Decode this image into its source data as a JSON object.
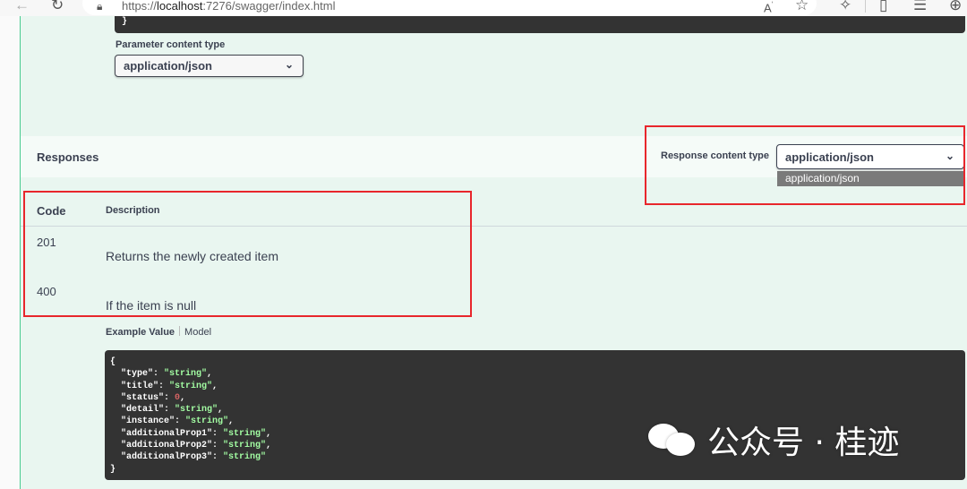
{
  "browser": {
    "url_scheme": "https://",
    "url_host": "localhost",
    "url_rest": ":7276/swagger/index.html",
    "icons": [
      "back-arrow-icon",
      "reload-icon",
      "lock-icon",
      "read-aloud-icon",
      "star-icon",
      "extensions-icon",
      "split-screen-icon",
      "favorites-icon",
      "collections-icon"
    ]
  },
  "request": {
    "code_strip_char": "}",
    "parameter_content_type_label": "Parameter content type",
    "parameter_content_type_value": "application/json"
  },
  "responses": {
    "title": "Responses",
    "content_type_label": "Response content type",
    "content_type_value": "application/json",
    "content_type_options": [
      "application/json"
    ],
    "table_headers": {
      "code": "Code",
      "description": "Description"
    },
    "rows": [
      {
        "code": "201",
        "description": "Returns the newly created item"
      },
      {
        "code": "400",
        "description": "If the item is null"
      }
    ],
    "example_tab_active": "Example Value",
    "example_tab_inactive": "Model",
    "example_value": {
      "open": "{",
      "close": "}",
      "lines": [
        {
          "key": "\"type\"",
          "value": "\"string\"",
          "kind": "str",
          "comma": true
        },
        {
          "key": "\"title\"",
          "value": "\"string\"",
          "kind": "str",
          "comma": true
        },
        {
          "key": "\"status\"",
          "value": "0",
          "kind": "num",
          "comma": true
        },
        {
          "key": "\"detail\"",
          "value": "\"string\"",
          "kind": "str",
          "comma": true
        },
        {
          "key": "\"instance\"",
          "value": "\"string\"",
          "kind": "str",
          "comma": true
        },
        {
          "key": "\"additionalProp1\"",
          "value": "\"string\"",
          "kind": "str",
          "comma": true
        },
        {
          "key": "\"additionalProp2\"",
          "value": "\"string\"",
          "kind": "str",
          "comma": true
        },
        {
          "key": "\"additionalProp3\"",
          "value": "\"string\"",
          "kind": "str",
          "comma": false
        }
      ]
    }
  },
  "colors": {
    "operation_bg": "#e9f6f0",
    "operation_border": "#49cc90",
    "highlight_border": "#e8262c",
    "code_bg": "#333333",
    "string_value": "#a2fca2",
    "number_value": "#d36363"
  },
  "watermark": {
    "text": "公众号 · 桂迹",
    "icon": "wechat-icon"
  }
}
